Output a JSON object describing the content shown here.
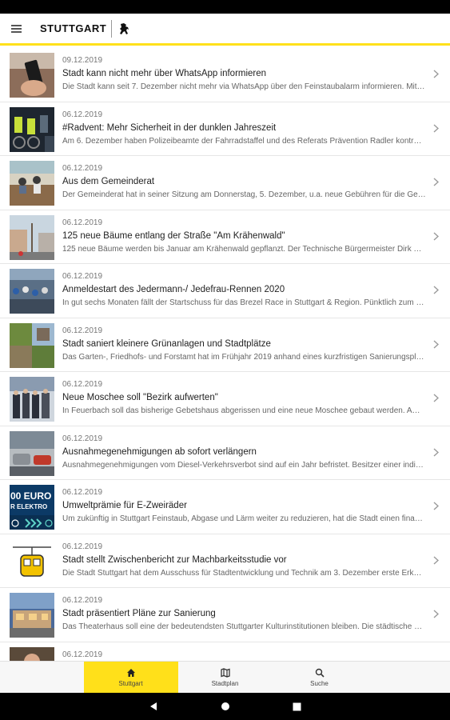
{
  "header": {
    "logo_text": "STUTTGART"
  },
  "news": [
    {
      "date": "09.12.2019",
      "title": "Stadt kann nicht mehr über WhatsApp informieren",
      "teaser": "Die Stadt kann seit 7. Dezember nicht mehr via WhatsApp über den Feinstaubalarm informieren. Mit No..."
    },
    {
      "date": "06.12.2019",
      "title": "#Radvent: Mehr Sicherheit in der dunklen Jahreszeit",
      "teaser": "Am 6. Dezember haben Polizeibeamte der Fahrradstaffel und des Referats Prävention Radler kontrollier..."
    },
    {
      "date": "06.12.2019",
      "title": "Aus dem Gemeinderat",
      "teaser": "Der Gemeinderat hat in seiner Sitzung am Donnerstag, 5. Dezember, u.a. neue Gebühren für die Gehweg..."
    },
    {
      "date": "06.12.2019",
      "title": "125 neue Bäume entlang der Straße \"Am Krähenwald\"",
      "teaser": "125 neue Bäume werden bis Januar am Krähenwald gepflanzt. Der Technische Bürgermeister Dirk Thür..."
    },
    {
      "date": "06.12.2019",
      "title": "Anmeldestart des Jedermann-/ Jedefrau-Rennen 2020",
      "teaser": "In gut sechs Monaten fällt der Startschuss für das Brezel Race in Stuttgart & Region. Pünktlich zum Nik..."
    },
    {
      "date": "06.12.2019",
      "title": "Stadt saniert kleinere Grünanlagen und Stadtplätze",
      "teaser": "Das Garten-, Friedhofs- und Forstamt hat im Frühjahr 2019 anhand eines kurzfristigen Sanierungsplans ..."
    },
    {
      "date": "06.12.2019",
      "title": "Neue Moschee soll \"Bezirk aufwerten\"",
      "teaser": "In Feuerbach soll das bisherige Gebetshaus abgerissen und eine neue Moschee gebaut werden. Am Mit..."
    },
    {
      "date": "06.12.2019",
      "title": "Ausnahmegenehmigungen ab sofort verlängern",
      "teaser": "Ausnahmegenehmigungen vom Diesel-Verkehrsverbot sind auf ein Jahr befristet. Besitzer einer individu..."
    },
    {
      "date": "06.12.2019",
      "title": "Umweltprämie für E-Zweiräder",
      "teaser": "Um zukünftig in Stuttgart Feinstaub, Abgase und Lärm weiter zu reduzieren, hat die Stadt einen finanziel..."
    },
    {
      "date": "06.12.2019",
      "title": "Stadt stellt Zwischenbericht zur Machbarkeitsstudie vor",
      "teaser": "Die Stadt Stuttgart hat dem Ausschuss für Stadtentwicklung und Technik am 3. Dezember erste Erkennt..."
    },
    {
      "date": "06.12.2019",
      "title": "Stadt präsentiert Pläne zur Sanierung",
      "teaser": "Das Theaterhaus soll eine der bedeutendsten Stuttgarter Kulturinstitutionen bleiben. Die städtische Kult..."
    },
    {
      "date": "06.12.2019",
      "title": "",
      "teaser": ""
    }
  ],
  "thumb_texts": {
    "euro_top": "00 EURO",
    "euro_bottom": "R ELEKTRO"
  },
  "bottom_nav": {
    "tabs": [
      {
        "label": "Stuttgart",
        "icon": "home-icon",
        "active": true
      },
      {
        "label": "Stadtplan",
        "icon": "map-icon",
        "active": false
      },
      {
        "label": "Suche",
        "icon": "search-icon",
        "active": false
      }
    ]
  },
  "colors": {
    "accent": "#ffe01a"
  }
}
